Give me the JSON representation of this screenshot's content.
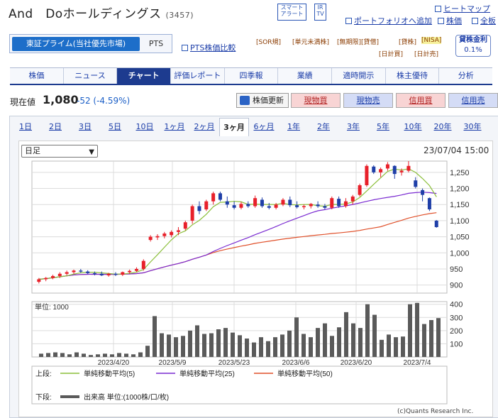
{
  "header": {
    "company": "And　Doホールディングス",
    "code": "(3457)",
    "badges": [
      {
        "label": "スマート アラート"
      },
      {
        "label": "IR TV"
      }
    ],
    "links": {
      "heatmap": "ヒートマップ",
      "portfolio": "ポートフォリオへ追加",
      "stock_board": "株価",
      "full_board": "全板"
    }
  },
  "market": {
    "primary": "東証プライム(当社優先市場)",
    "pts": "PTS",
    "pts_compare": "PTS株価比較"
  },
  "flags": [
    "[SOR規]",
    "[単元未満株]",
    "[無期限][貸借]",
    "[貸株]",
    "[NISA]",
    "[日計買]",
    "[日計売]"
  ],
  "lending": {
    "label": "貸株金利",
    "rate": "0.1%"
  },
  "tabs": [
    "株価",
    "ニュース",
    "チャート",
    "評価レポート",
    "四季報",
    "業績",
    "適時開示",
    "株主優待",
    "分析"
  ],
  "active_tab": "チャート",
  "quote": {
    "label": "現在値",
    "price": "1,080",
    "change": "-52 (-4.59%)"
  },
  "buttons": {
    "refresh": "株価更新",
    "cash_buy": "現物買",
    "cash_sell": "現物売",
    "margin_buy": "信用買",
    "margin_sell": "信用売"
  },
  "periods": [
    "1日",
    "2日",
    "3日",
    "5日",
    "10日",
    "1ヶ月",
    "2ヶ月",
    "3ヶ月",
    "6ヶ月",
    "1年",
    "2年",
    "3年",
    "5年",
    "10年",
    "20年",
    "30年"
  ],
  "active_period": "3ヶ月",
  "chart_controls": {
    "range": "日足",
    "timestamp": "23/07/04 15:00"
  },
  "legend": {
    "upper": "上段:",
    "lower": "下段:",
    "ma5": "単純移動平均(5)",
    "ma25": "単純移動平均(25)",
    "ma50": "単純移動平均(50)",
    "volume": "出来高 単位:(1000株/口/枚)"
  },
  "copyright": "(c)Quants Research Inc.",
  "colors": {
    "up": "#e8202a",
    "down": "#1f3fa8",
    "ma5": "#8bbf3a",
    "ma25": "#7a2bd1",
    "ma50": "#e0502a",
    "volume": "#5a5a5a",
    "tab_active": "#1d3b8f"
  },
  "chart_data": {
    "type": "candlestick",
    "title": "",
    "x_ticks": [
      "2023/4/20",
      "2023/5/9",
      "2023/5/23",
      "2023/6/6",
      "2023/6/20",
      "2023/7/4"
    ],
    "y_ticks": [
      900,
      950,
      1000,
      1050,
      1100,
      1150,
      1200,
      1250
    ],
    "ylim": [
      875,
      1285
    ],
    "volume_label": "単位: 1000",
    "volume_ticks": [
      100,
      200,
      300,
      400
    ],
    "volume_ylim": [
      0,
      420
    ],
    "candles": [
      {
        "o": 910,
        "h": 922,
        "l": 905,
        "c": 918
      },
      {
        "o": 918,
        "h": 925,
        "l": 912,
        "c": 922
      },
      {
        "o": 922,
        "h": 932,
        "l": 918,
        "c": 928
      },
      {
        "o": 928,
        "h": 940,
        "l": 922,
        "c": 935
      },
      {
        "o": 935,
        "h": 945,
        "l": 930,
        "c": 940
      },
      {
        "o": 940,
        "h": 948,
        "l": 935,
        "c": 945
      },
      {
        "o": 945,
        "h": 950,
        "l": 938,
        "c": 942
      },
      {
        "o": 942,
        "h": 946,
        "l": 934,
        "c": 937
      },
      {
        "o": 937,
        "h": 942,
        "l": 930,
        "c": 935
      },
      {
        "o": 935,
        "h": 942,
        "l": 928,
        "c": 930
      },
      {
        "o": 930,
        "h": 938,
        "l": 926,
        "c": 935
      },
      {
        "o": 935,
        "h": 940,
        "l": 928,
        "c": 932
      },
      {
        "o": 932,
        "h": 942,
        "l": 928,
        "c": 940
      },
      {
        "o": 940,
        "h": 948,
        "l": 935,
        "c": 944
      },
      {
        "o": 944,
        "h": 955,
        "l": 940,
        "c": 950
      },
      {
        "o": 950,
        "h": 980,
        "l": 945,
        "c": 975
      },
      {
        "o": 1040,
        "h": 1055,
        "l": 1035,
        "c": 1050
      },
      {
        "o": 1048,
        "h": 1058,
        "l": 1040,
        "c": 1052
      },
      {
        "o": 1052,
        "h": 1065,
        "l": 1045,
        "c": 1060
      },
      {
        "o": 1055,
        "h": 1070,
        "l": 1048,
        "c": 1065
      },
      {
        "o": 1065,
        "h": 1080,
        "l": 1055,
        "c": 1070
      },
      {
        "o": 1075,
        "h": 1100,
        "l": 1070,
        "c": 1095
      },
      {
        "o": 1100,
        "h": 1150,
        "l": 1090,
        "c": 1145
      },
      {
        "o": 1145,
        "h": 1160,
        "l": 1120,
        "c": 1130
      },
      {
        "o": 1135,
        "h": 1165,
        "l": 1130,
        "c": 1160
      },
      {
        "o": 1160,
        "h": 1190,
        "l": 1150,
        "c": 1185
      },
      {
        "o": 1185,
        "h": 1190,
        "l": 1160,
        "c": 1165
      },
      {
        "o": 1160,
        "h": 1175,
        "l": 1140,
        "c": 1150
      },
      {
        "o": 1148,
        "h": 1160,
        "l": 1135,
        "c": 1140
      },
      {
        "o": 1140,
        "h": 1158,
        "l": 1135,
        "c": 1152
      },
      {
        "o": 1152,
        "h": 1160,
        "l": 1140,
        "c": 1145
      },
      {
        "o": 1145,
        "h": 1178,
        "l": 1140,
        "c": 1170
      },
      {
        "o": 1165,
        "h": 1172,
        "l": 1140,
        "c": 1145
      },
      {
        "o": 1145,
        "h": 1155,
        "l": 1135,
        "c": 1140
      },
      {
        "o": 1140,
        "h": 1155,
        "l": 1135,
        "c": 1150
      },
      {
        "o": 1150,
        "h": 1170,
        "l": 1145,
        "c": 1165
      },
      {
        "o": 1165,
        "h": 1175,
        "l": 1142,
        "c": 1148
      },
      {
        "o": 1148,
        "h": 1160,
        "l": 1138,
        "c": 1142
      },
      {
        "o": 1142,
        "h": 1150,
        "l": 1135,
        "c": 1145
      },
      {
        "o": 1145,
        "h": 1155,
        "l": 1138,
        "c": 1152
      },
      {
        "o": 1150,
        "h": 1160,
        "l": 1140,
        "c": 1145
      },
      {
        "o": 1145,
        "h": 1152,
        "l": 1135,
        "c": 1140
      },
      {
        "o": 1140,
        "h": 1175,
        "l": 1135,
        "c": 1170
      },
      {
        "o": 1168,
        "h": 1175,
        "l": 1140,
        "c": 1145
      },
      {
        "o": 1145,
        "h": 1170,
        "l": 1140,
        "c": 1160
      },
      {
        "o": 1160,
        "h": 1180,
        "l": 1150,
        "c": 1175
      },
      {
        "o": 1180,
        "h": 1215,
        "l": 1175,
        "c": 1210
      },
      {
        "o": 1210,
        "h": 1275,
        "l": 1205,
        "c": 1270
      },
      {
        "o": 1268,
        "h": 1272,
        "l": 1245,
        "c": 1250
      },
      {
        "o": 1250,
        "h": 1265,
        "l": 1235,
        "c": 1260
      },
      {
        "o": 1262,
        "h": 1282,
        "l": 1255,
        "c": 1275
      },
      {
        "o": 1270,
        "h": 1272,
        "l": 1230,
        "c": 1245
      },
      {
        "o": 1250,
        "h": 1262,
        "l": 1240,
        "c": 1255
      },
      {
        "o": 1255,
        "h": 1285,
        "l": 1250,
        "c": 1270
      },
      {
        "o": 1225,
        "h": 1235,
        "l": 1200,
        "c": 1205
      },
      {
        "o": 1195,
        "h": 1200,
        "l": 1160,
        "c": 1180
      },
      {
        "o": 1170,
        "h": 1172,
        "l": 1130,
        "c": 1135
      },
      {
        "o": 1100,
        "h": 1102,
        "l": 1078,
        "c": 1080
      }
    ],
    "volume": [
      25,
      30,
      35,
      30,
      20,
      35,
      25,
      15,
      20,
      25,
      20,
      30,
      25,
      20,
      35,
      85,
      310,
      180,
      170,
      150,
      160,
      200,
      240,
      175,
      180,
      210,
      220,
      185,
      165,
      140,
      110,
      150,
      120,
      150,
      170,
      200,
      300,
      175,
      150,
      220,
      255,
      160,
      225,
      340,
      255,
      220,
      400,
      320,
      130,
      170,
      150,
      155,
      400,
      410,
      250,
      280,
      295
    ]
  }
}
